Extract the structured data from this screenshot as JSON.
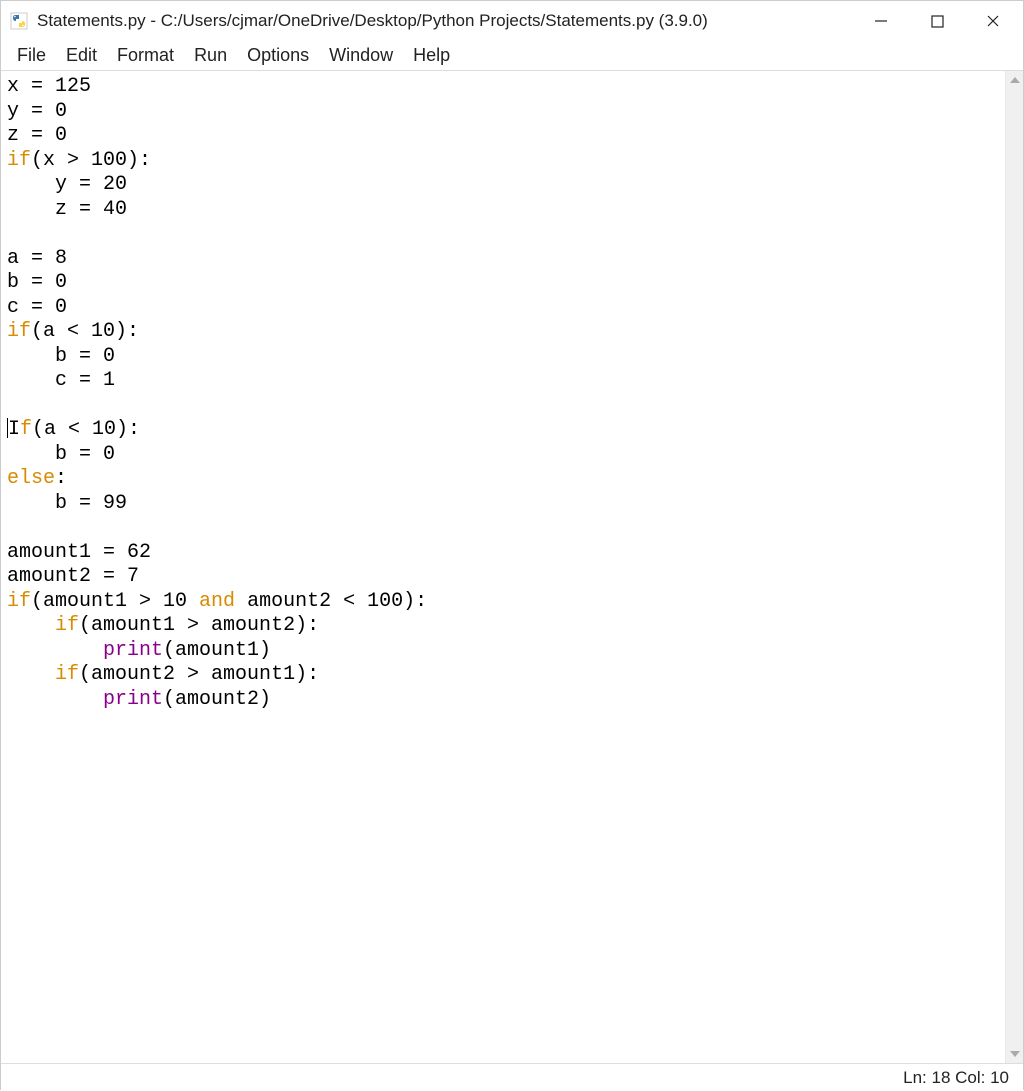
{
  "window": {
    "title": "Statements.py - C:/Users/cjmar/OneDrive/Desktop/Python Projects/Statements.py (3.9.0)"
  },
  "menu": {
    "file": "File",
    "edit": "Edit",
    "format": "Format",
    "run": "Run",
    "options": "Options",
    "window": "Window",
    "help": "Help"
  },
  "code": {
    "l1_a": "x = 125",
    "l2_a": "y = 0",
    "l3_a": "z = 0",
    "l4_kw": "if",
    "l4_b": "(x > 100):",
    "l5_a": "    y = 20",
    "l6_a": "    z = 40",
    "l7_a": "",
    "l8_a": "a = 8",
    "l9_a": "b = 0",
    "l10_a": "c = 0",
    "l11_kw": "if",
    "l11_b": "(a < 10):",
    "l12_a": "    b = 0",
    "l13_a": "    c = 1",
    "l14_a": "",
    "l15_a": "I",
    "l15_kw": "f",
    "l15_b": "(a < 10):",
    "l16_a": "    b = 0",
    "l17_kw": "else",
    "l17_b": ":",
    "l18_a": "    b = 99",
    "l19_a": "",
    "l20_a": "amount1 = 62",
    "l21_a": "amount2 = 7",
    "l22_kw": "if",
    "l22_b": "(amount1 > 10 ",
    "l22_kw2": "and",
    "l22_c": " amount2 < 100):",
    "l23_a": "    ",
    "l23_kw": "if",
    "l23_b": "(amount1 > amount2):",
    "l24_a": "        ",
    "l24_fn": "print",
    "l24_b": "(amount1)",
    "l25_a": "    ",
    "l25_kw": "if",
    "l25_b": "(amount2 > amount1):",
    "l26_a": "        ",
    "l26_fn": "print",
    "l26_b": "(amount2)"
  },
  "status": {
    "position": "Ln: 18  Col: 10"
  }
}
